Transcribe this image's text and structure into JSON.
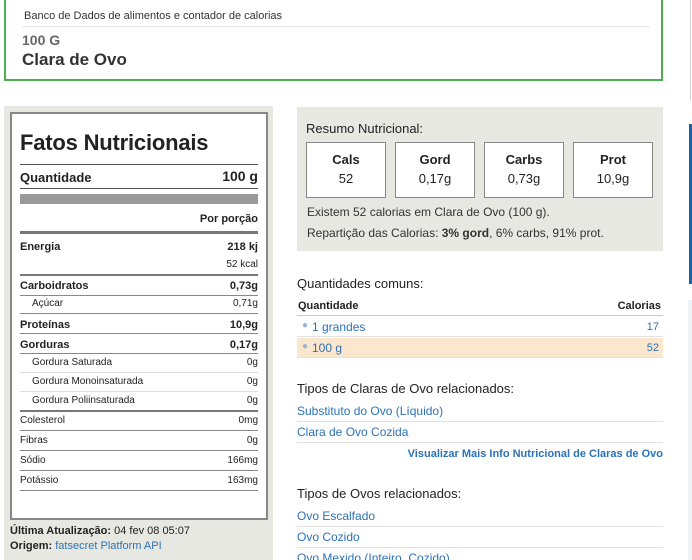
{
  "header": {
    "subtitle": "Banco de Dados de alimentos e contador de calorias",
    "quantity": "100 G",
    "food_name": "Clara de Ovo"
  },
  "facts": {
    "title": "Fatos Nutricionais",
    "quantity_label": "Quantidade",
    "quantity_value": "100 g",
    "per_portion": "Por porção",
    "rows": [
      {
        "label": "Energia",
        "value": "218 kj",
        "bold": true
      },
      {
        "label": "",
        "value": "52 kcal",
        "bold": false
      },
      {
        "label": "Carboidratos",
        "value": "0,73g",
        "bold": true
      },
      {
        "label": "Açúcar",
        "value": "0,71g",
        "bold": false
      },
      {
        "label": "Proteínas",
        "value": "10,9g",
        "bold": true
      },
      {
        "label": "Gorduras",
        "value": "0,17g",
        "bold": true
      },
      {
        "label": "Gordura Saturada",
        "value": "0g",
        "bold": false
      },
      {
        "label": "Gordura Monoinsaturada",
        "value": "0g",
        "bold": false
      },
      {
        "label": "Gordura Poliinsaturada",
        "value": "0g",
        "bold": false
      },
      {
        "label": "Colesterol",
        "value": "0mg",
        "bold": false
      },
      {
        "label": "Fibras",
        "value": "0g",
        "bold": false
      },
      {
        "label": "Sódio",
        "value": "166mg",
        "bold": false
      },
      {
        "label": "Potássio",
        "value": "163mg",
        "bold": false
      }
    ],
    "last_update_label": "Última Atualização:",
    "last_update_value": "04 fev 08 05:07",
    "source_label": "Origem:",
    "source_value": "fatsecret Platform API"
  },
  "summary": {
    "title": "Resumo Nutricional:",
    "macros": [
      {
        "label": "Cals",
        "value": "52"
      },
      {
        "label": "Gord",
        "value": "0,17g"
      },
      {
        "label": "Carbs",
        "value": "0,73g"
      },
      {
        "label": "Prot",
        "value": "10,9g"
      }
    ],
    "text1": "Existem 52 calorias em Clara de Ovo (100 g).",
    "text2_prefix": "Repartição das Calorias: ",
    "text2_bold": "3% gord",
    "text2_suffix": ", 6% carbs, 91% prot."
  },
  "common": {
    "title": "Quantidades comuns:",
    "col_qty": "Quantidade",
    "col_cal": "Calorias",
    "rows": [
      {
        "qty": "1 grandes",
        "cal": "17"
      },
      {
        "qty": "100 g",
        "cal": "52"
      }
    ]
  },
  "related_whites": {
    "title": "Tipos de Claras de Ovo relacionados:",
    "items": [
      "Substituto do Ovo (Líquido)",
      "Clara de Ovo Cozida"
    ],
    "more_link": "Visualizar Mais Info Nutricional de Claras de Ovo"
  },
  "related_eggs": {
    "title": "Tipos de Ovos relacionados:",
    "items": [
      "Ovo Escalfado",
      "Ovo Cozido",
      "Ovo Mexido (Inteiro, Cozido)"
    ]
  },
  "colors": {
    "header_border": "#4caf50",
    "panel_bg": "#e6e8e1",
    "link": "#2b73b7",
    "highlight_row": "#fae7cd"
  }
}
